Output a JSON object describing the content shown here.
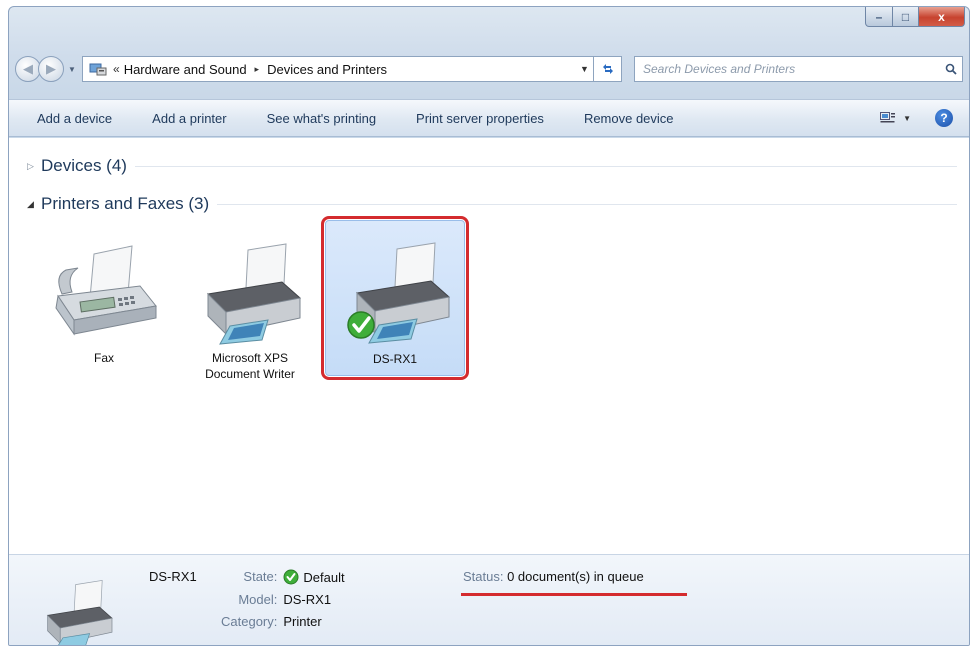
{
  "window": {
    "caption": {
      "minimize": "–",
      "maximize": "□",
      "close": "x"
    }
  },
  "address": {
    "chevrons": "«",
    "crumbs": [
      "Hardware and Sound",
      "Devices and Printers"
    ],
    "separator": "▸"
  },
  "search": {
    "placeholder": "Search Devices and Printers"
  },
  "commands": [
    "Add a device",
    "Add a printer",
    "See what's printing",
    "Print server properties",
    "Remove device"
  ],
  "groups": {
    "devices": {
      "label": "Devices (4)",
      "expanded": false
    },
    "printers": {
      "label": "Printers and Faxes (3)",
      "expanded": true
    }
  },
  "items": [
    {
      "name": "Fax",
      "icon": "fax-icon"
    },
    {
      "name": "Microsoft XPS\nDocument Writer",
      "line1": "Microsoft XPS",
      "line2": "Document Writer",
      "icon": "printer-icon"
    },
    {
      "name": "DS-RX1",
      "icon": "printer-default-icon",
      "selected": true,
      "default": true
    }
  ],
  "details": {
    "name": "DS-RX1",
    "state_label": "State:",
    "state_value": "Default",
    "model_label": "Model:",
    "model_value": "DS-RX1",
    "category_label": "Category:",
    "category_value": "Printer",
    "status_label": "Status:",
    "status_value": "0 document(s) in queue"
  },
  "colors": {
    "highlight": "#d42b2e",
    "selection": "#c5dcf7",
    "text": "#1e395b"
  }
}
